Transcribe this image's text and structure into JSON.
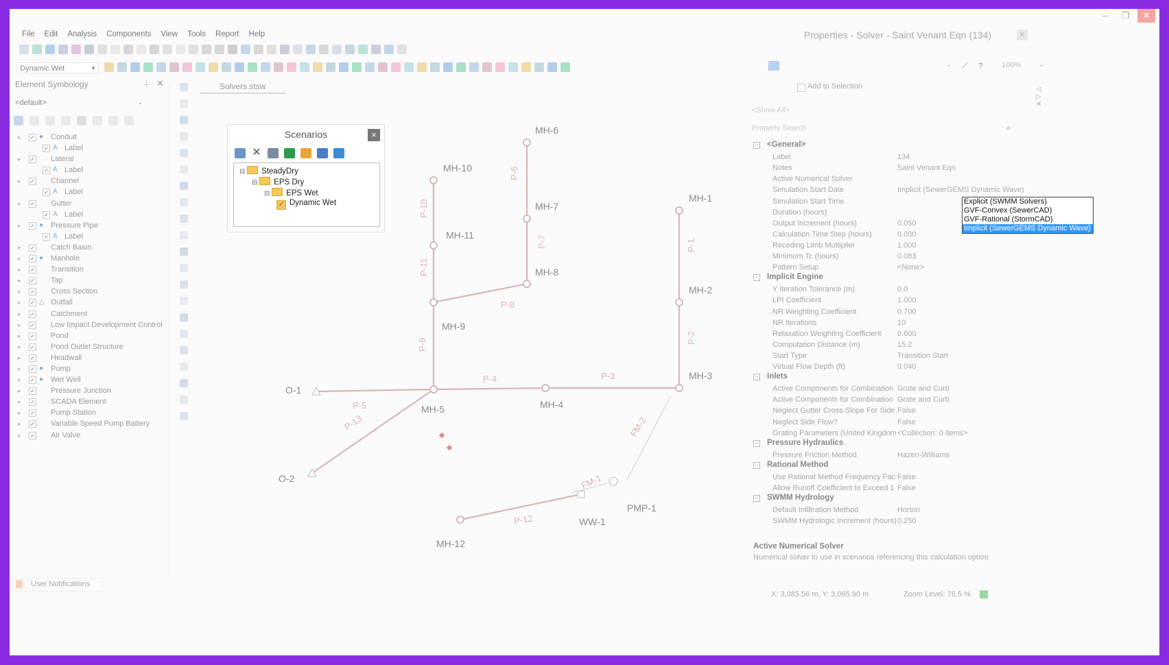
{
  "menu": [
    "File",
    "Edit",
    "Analysis",
    "Components",
    "View",
    "Tools",
    "Report",
    "Help"
  ],
  "scenario_combo": "Dynamic Wet",
  "element_symbology": {
    "title": "Element Symbology",
    "default_combo": "<default>",
    "items": [
      {
        "label": "Conduit",
        "level": 0,
        "icon": "conduit-icon"
      },
      {
        "label": "Label",
        "level": 1,
        "icon": "label-icon"
      },
      {
        "label": "Lateral",
        "level": 0,
        "icon": ""
      },
      {
        "label": "Label",
        "level": 1,
        "icon": "label-icon"
      },
      {
        "label": "Channel",
        "level": 0,
        "icon": ""
      },
      {
        "label": "Label",
        "level": 1,
        "icon": "label-icon"
      },
      {
        "label": "Gutter",
        "level": 0,
        "icon": ""
      },
      {
        "label": "Label",
        "level": 1,
        "icon": "label-icon"
      },
      {
        "label": "Pressure Pipe",
        "level": 0,
        "icon": "pressure-pipe-icon"
      },
      {
        "label": "Label",
        "level": 1,
        "icon": "label-icon"
      },
      {
        "label": "Catch Basin",
        "level": 0,
        "icon": ""
      },
      {
        "label": "Manhole",
        "level": 0,
        "icon": "manhole-icon"
      },
      {
        "label": "Transition",
        "level": 0,
        "icon": ""
      },
      {
        "label": "Tap",
        "level": 0,
        "icon": ""
      },
      {
        "label": "Cross Section",
        "level": 0,
        "icon": ""
      },
      {
        "label": "Outfall",
        "level": 0,
        "icon": "outfall-icon"
      },
      {
        "label": "Catchment",
        "level": 0,
        "icon": ""
      },
      {
        "label": "Low Impact Development Control",
        "level": 0,
        "icon": ""
      },
      {
        "label": "Pond",
        "level": 0,
        "icon": ""
      },
      {
        "label": "Pond Outlet Structure",
        "level": 0,
        "icon": ""
      },
      {
        "label": "Headwall",
        "level": 0,
        "icon": ""
      },
      {
        "label": "Pump",
        "level": 0,
        "icon": "pump-icon"
      },
      {
        "label": "Wet Well",
        "level": 0,
        "icon": "wet-well-icon"
      },
      {
        "label": "Pressure Junction",
        "level": 0,
        "icon": ""
      },
      {
        "label": "SCADA Element",
        "level": 0,
        "icon": ""
      },
      {
        "label": "Pump Station",
        "level": 0,
        "icon": ""
      },
      {
        "label": "Variable Speed Pump Battery",
        "level": 0,
        "icon": ""
      },
      {
        "label": "Air Valve",
        "level": 0,
        "icon": ""
      }
    ]
  },
  "document_tab": "Solvers.stsw",
  "scenarios": {
    "title": "Scenarios",
    "close": "×",
    "tree": [
      {
        "label": "SteadyDry",
        "level": 0,
        "icon": "folder"
      },
      {
        "label": "EPS Dry",
        "level": 1,
        "icon": "folder"
      },
      {
        "label": "EPS Wet",
        "level": 2,
        "icon": "folder"
      },
      {
        "label": "Dynamic Wet",
        "level": 3,
        "icon": "checked"
      }
    ]
  },
  "network": {
    "nodes": {
      "MH-6": "MH-6",
      "MH-10": "MH-10",
      "MH-7": "MH-7",
      "MH-1": "MH-1",
      "MH-11": "MH-11",
      "MH-8": "MH-8",
      "MH-2": "MH-2",
      "MH-9": "MH-9",
      "MH-3": "MH-3",
      "O-1": "O-1",
      "MH-4": "MH-4",
      "MH-5": "MH-5",
      "O-2": "O-2",
      "PMP-1": "PMP-1",
      "WW-1": "WW-1",
      "MH-12": "MH-12"
    },
    "pipes": {
      "P-6": "P-6",
      "P-10": "P-10",
      "P-7": "P-7",
      "P-1": "P-1",
      "P-11": "P-11",
      "P-8": "P-8",
      "P-9": "P-9",
      "P-2": "P-2",
      "P-4": "P-4",
      "P-3": "P-3",
      "P-5": "P-5",
      "P-13": "P-13",
      "FM-2": "FM-2",
      "FM-1": "FM-1",
      "P-12": "P-12"
    }
  },
  "properties": {
    "title": "Properties - Solver - Saint Venant Eqn (134)",
    "zoom": "100%",
    "add_to_selection": "Add to Selection",
    "show_all": "<Show All>",
    "search_placeholder": "Property Search",
    "sections": [
      {
        "title": "<General>",
        "rows": [
          [
            "Label",
            "134"
          ],
          [
            "Notes",
            "Saint Venant Eqn"
          ],
          [
            "Active Numerical Solver",
            ""
          ],
          [
            "Simulation Start Date",
            "Implicit (SewerGEMS Dynamic Wave)"
          ],
          [
            "Simulation Start Time",
            ""
          ],
          [
            "Duration (hours)",
            ""
          ],
          [
            "Output Increment (hours)",
            "0.050"
          ],
          [
            "Calculation Time Step (hours)",
            "0.050"
          ],
          [
            "Receding Limb Multiplier",
            "1.000"
          ],
          [
            "Minimum Tc (hours)",
            "0.083"
          ],
          [
            "Pattern Setup",
            "<None>"
          ]
        ]
      },
      {
        "title": "Implicit Engine",
        "rows": [
          [
            "Y Iteration Tolerance (m)",
            "0.0"
          ],
          [
            "LPI Coefficient",
            "1.000"
          ],
          [
            "NR Weighting Coefficient",
            "0.700"
          ],
          [
            "NR Iterations",
            "10"
          ],
          [
            "Relaxation Weighting Coefficient",
            "0.600"
          ],
          [
            "Computation Distance (m)",
            "15.2"
          ],
          [
            "Start Type",
            "Transition Start"
          ],
          [
            "Virtual Flow Depth (ft)",
            "0.040"
          ]
        ]
      },
      {
        "title": "Inlets",
        "rows": [
          [
            "Active Components for Combination",
            "Grate and Curb"
          ],
          [
            "Active Components for Combination",
            "Grate and Curb"
          ],
          [
            "Neglect Gutter Cross Slope For Side",
            "False"
          ],
          [
            "Neglect Side Flow?",
            "False"
          ],
          [
            "Grating Parameters (United Kingdom)",
            "<Collection: 0 items>"
          ]
        ]
      },
      {
        "title": "Pressure Hydraulics",
        "rows": [
          [
            "Pressure Friction Method",
            "Hazen-Williams"
          ]
        ]
      },
      {
        "title": "Rational Method",
        "rows": [
          [
            "Use Rational Method Frequency Factor",
            "False"
          ],
          [
            "Allow Runoff Coefficient to Exceed 1",
            "False"
          ]
        ]
      },
      {
        "title": "SWMM Hydrology",
        "rows": [
          [
            "Default Infiltration Method",
            "Horton"
          ],
          [
            "SWMM Hydrologic Increment (hours)",
            "0.250"
          ]
        ]
      }
    ],
    "dropdown": [
      "Explicit (SWMM Solvers)",
      "GVF-Convex (SewerCAD)",
      "GVF-Rational (StormCAD)",
      "Implicit (SewerGEMS Dynamic Wave)"
    ],
    "dropdown_selected": "Implicit (SewerGEMS Dynamic Wave)",
    "desc_title": "Active Numerical Solver",
    "desc_text": "Numerical solver to use in scenarios referencing this calculation option"
  },
  "status": {
    "notifications": "User Notifications",
    "coords": "X: 3,085.56 m, Y: 3,065.90 m",
    "zoom": "Zoom Level: 76.5 %"
  },
  "colors": {
    "frame": "#8a2be2",
    "pipe": "#d8b3b3",
    "select": "#3399ff"
  }
}
